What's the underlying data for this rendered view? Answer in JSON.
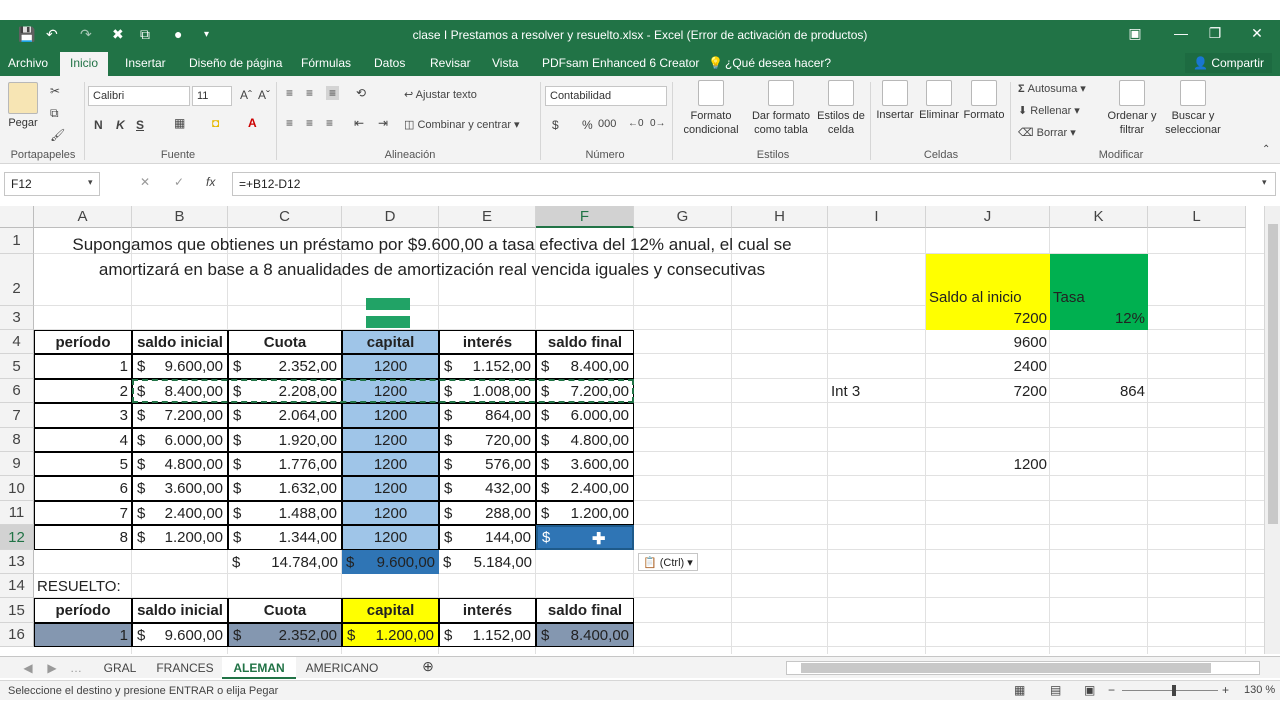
{
  "window": {
    "title": "clase I Prestamos a resolver y resuelto.xlsx - Excel (Error de activación de productos)",
    "colors": {
      "excel_green": "#217346",
      "header_blue": "#9fc5e8",
      "selected_blue": "#2f75b5",
      "yellow": "#ffff00",
      "green": "#00b050",
      "gray_blue": "#8497b0"
    }
  },
  "menu": {
    "tabs": [
      "Archivo",
      "Inicio",
      "Insertar",
      "Diseño de página",
      "Fórmulas",
      "Datos",
      "Revisar",
      "Vista",
      "PDFsam Enhanced 6 Creator"
    ],
    "tell_me": "¿Qué desea hacer?",
    "share": "Compartir"
  },
  "ribbon": {
    "paste": "Pegar",
    "font_name": "Calibri",
    "font_size": "11",
    "bold": "N",
    "italic": "K",
    "underline": "S",
    "wrap": "Ajustar texto",
    "merge": "Combinar y centrar",
    "number_format": "Contabilidad",
    "currency": "$",
    "percent": "%",
    "thousands": "000",
    "cond_format": "Formato condicional",
    "format_table": "Dar formato como tabla",
    "cell_styles": "Estilos de celda",
    "insert": "Insertar",
    "delete": "Eliminar",
    "format": "Formato",
    "autosum": "Autosuma",
    "fill": "Rellenar",
    "clear": "Borrar",
    "sort": "Ordenar y filtrar",
    "find": "Buscar y seleccionar",
    "groups": [
      "Portapapeles",
      "Fuente",
      "Alineación",
      "Número",
      "Estilos",
      "Celdas",
      "Modificar"
    ]
  },
  "formula_bar": {
    "name_box": "F12",
    "fx": "fx",
    "formula": "=+B12-D12"
  },
  "sheet": {
    "columns": [
      "A",
      "B",
      "C",
      "D",
      "E",
      "F",
      "G",
      "H",
      "I",
      "J",
      "K",
      "L"
    ],
    "rows": [
      "1",
      "2",
      "3",
      "4",
      "5",
      "6",
      "7",
      "8",
      "9",
      "10",
      "11",
      "12",
      "13",
      "14",
      "15",
      "16"
    ],
    "problem_text": "Supongamos que obtienes un préstamo por $9.600,00 a tasa efectiva del 12% anual, el cual se amortizará en base a 8 anualidades de amortización real vencida iguales y consecutivas",
    "headers": [
      "período",
      "saldo inicial",
      "Cuota",
      "capital",
      "interés",
      "saldo final"
    ],
    "table_rows": [
      [
        "1",
        "9.600,00",
        "2.352,00",
        "1200",
        "1.152,00",
        "8.400,00"
      ],
      [
        "2",
        "8.400,00",
        "2.208,00",
        "1200",
        "1.008,00",
        "7.200,00"
      ],
      [
        "3",
        "7.200,00",
        "2.064,00",
        "1200",
        "864,00",
        "6.000,00"
      ],
      [
        "4",
        "6.000,00",
        "1.920,00",
        "1200",
        "720,00",
        "4.800,00"
      ],
      [
        "5",
        "4.800,00",
        "1.776,00",
        "1200",
        "576,00",
        "3.600,00"
      ],
      [
        "6",
        "3.600,00",
        "1.632,00",
        "1200",
        "432,00",
        "2.400,00"
      ],
      [
        "7",
        "2.400,00",
        "1.488,00",
        "1200",
        "288,00",
        "1.200,00"
      ],
      [
        "8",
        "1.200,00",
        "1.344,00",
        "1200",
        "144,00",
        ""
      ]
    ],
    "totals": {
      "cuota": "14.784,00",
      "capital": "9.600,00",
      "interes": "5.184,00"
    },
    "currency_symbol": "$",
    "resuelto_label": "RESUELTO:",
    "resuelto_row16": [
      "1",
      "9.600,00",
      "2.352,00",
      "1.200,00",
      "1.152,00",
      "8.400,00"
    ],
    "side": {
      "saldo_label": "Saldo al inicio",
      "tasa_label": "Tasa",
      "saldo_value": "7200",
      "tasa_value": "12%",
      "j4": "9600",
      "j5": "2400",
      "i6": "Int 3",
      "j6": "7200",
      "k6": "864",
      "j9": "1200"
    },
    "paste_options": "(Ctrl)"
  },
  "sheet_tabs": [
    "GRAL",
    "FRANCES",
    "ALEMAN",
    "AMERICANO"
  ],
  "active_tab": "ALEMAN",
  "status": {
    "message": "Seleccione el destino y presione ENTRAR o elija Pegar",
    "zoom": "130 %"
  }
}
